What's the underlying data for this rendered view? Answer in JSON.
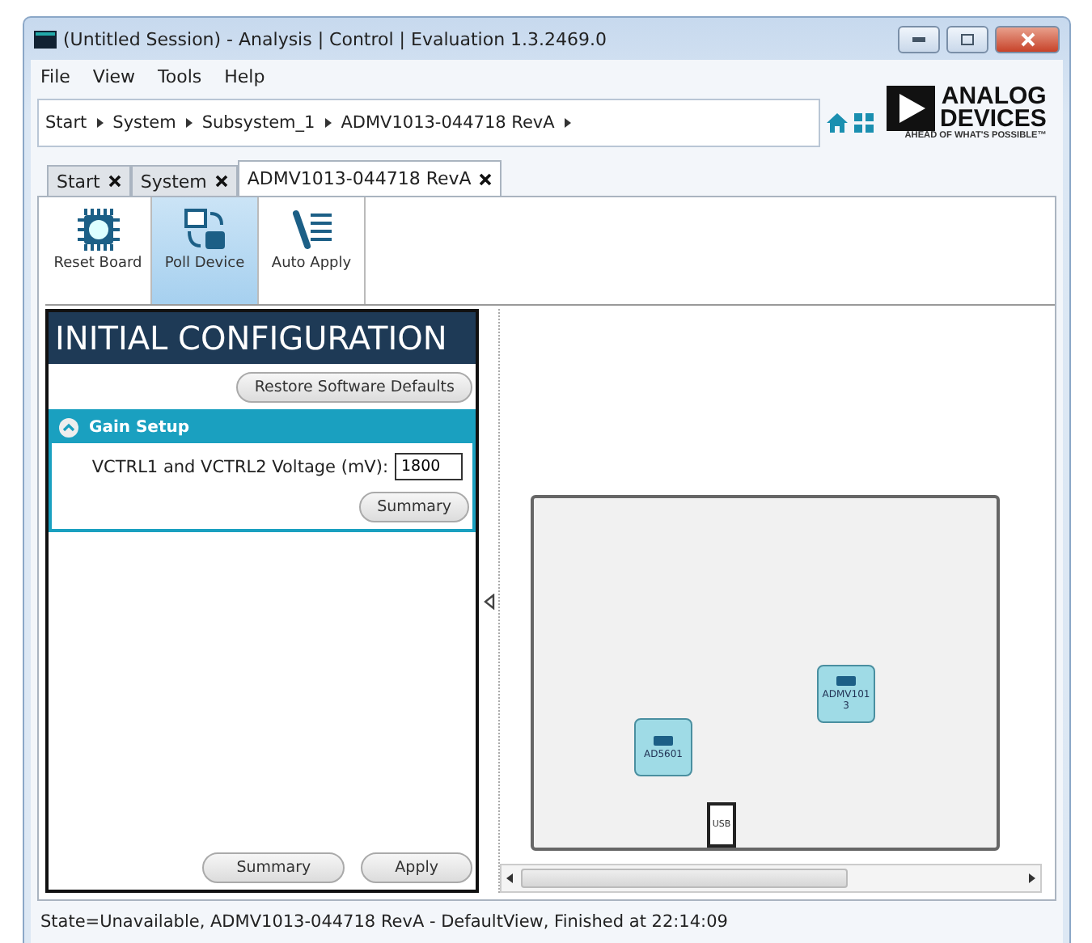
{
  "window": {
    "title": "(Untitled Session) - Analysis | Control | Evaluation 1.3.2469.0"
  },
  "menu": [
    "File",
    "View",
    "Tools",
    "Help"
  ],
  "breadcrumb": [
    "Start",
    "System",
    "Subsystem_1",
    "ADMV1013-044718 RevA"
  ],
  "logo": {
    "name_lines": [
      "ANALOG",
      "DEVICES"
    ],
    "tagline": "AHEAD OF WHAT'S POSSIBLE™"
  },
  "tabs": [
    {
      "label": "Start",
      "selected": false
    },
    {
      "label": "System",
      "selected": false
    },
    {
      "label": "ADMV1013-044718 RevA",
      "selected": true
    }
  ],
  "toolbar": [
    {
      "label": "Reset Board",
      "kind": "reset",
      "selected": false
    },
    {
      "label": "Poll Device",
      "kind": "poll",
      "selected": true
    },
    {
      "label": "Auto Apply",
      "kind": "apply",
      "selected": false
    }
  ],
  "config_panel": {
    "title": "INITIAL CONFIGURATION",
    "restore_button": "Restore Software Defaults",
    "sections": [
      {
        "title": "Gain Setup",
        "expanded": true,
        "fields": [
          {
            "label": "VCTRL1 and VCTRL2 Voltage (mV):",
            "value": "1800"
          }
        ],
        "button": "Summary"
      }
    ],
    "buttons": [
      "Summary",
      "Apply"
    ]
  },
  "diagram": {
    "components": [
      {
        "kind": "chip",
        "label": "AD5601"
      },
      {
        "kind": "chip",
        "label": "ADMV1013"
      },
      {
        "kind": "port",
        "label": "USB"
      }
    ]
  },
  "status_bar": "State=Unavailable, ADMV1013-044718 RevA - DefaultView, Finished at 22:14:09"
}
